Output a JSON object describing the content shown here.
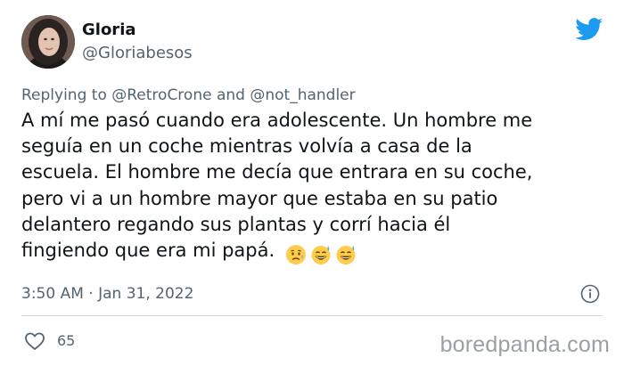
{
  "user": {
    "display_name": "Gloria",
    "handle": "@Gloriabesos"
  },
  "reply_context": {
    "prefix": "Replying to",
    "mention_1": "@RetroCrone",
    "joiner": "and",
    "mention_2": "@not_handler"
  },
  "tweet": {
    "lines": [
      "A mí me pasó cuando era adolescente. Un hombre me",
      "seguía en un coche mientras volvía a casa de la",
      "escuela. El hombre me decía que entrara en su coche,",
      "pero vi a un hombre mayor que estaba en su patio",
      "delantero regando sus plantas y corrí hacia él",
      "fingiendo que era mi papá."
    ],
    "emojis": [
      "worried-face-emoji",
      "grinning-sweat-emoji",
      "grinning-sweat-emoji"
    ],
    "timestamp": "3:50 AM · Jan 31, 2022"
  },
  "engagement": {
    "likes": "65"
  },
  "watermark": "boredpanda.com",
  "colors": {
    "twitter_blue": "#1d9bf0",
    "secondary_text": "#536471",
    "primary_text": "#0f1419",
    "divider": "#cfd9de"
  }
}
